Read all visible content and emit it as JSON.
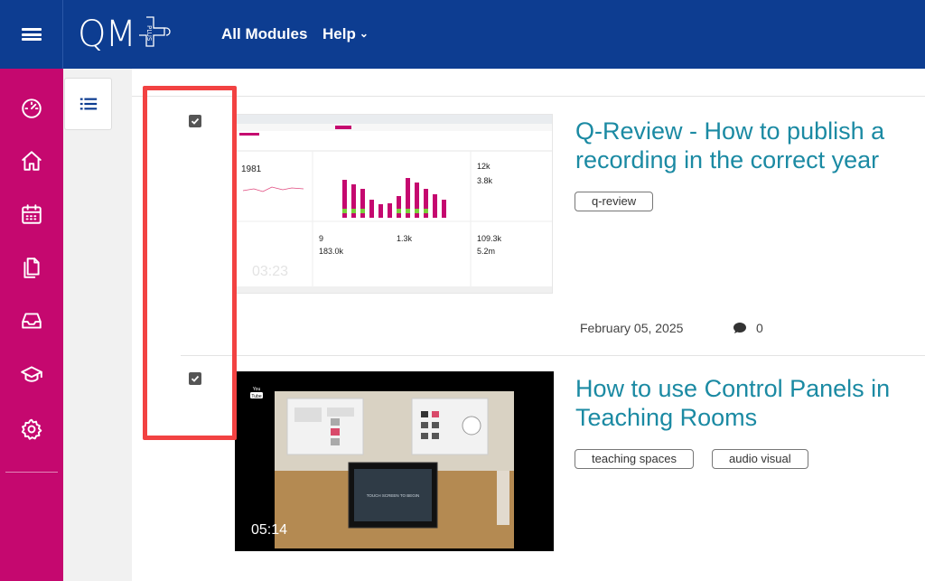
{
  "header": {
    "logo_text": "QM",
    "logo_plus_text": "PLUS",
    "nav": {
      "all_modules": "All Modules",
      "help": "Help"
    }
  },
  "sidebar": {
    "items": [
      {
        "icon": "dashboard-icon"
      },
      {
        "icon": "home-icon"
      },
      {
        "icon": "calendar-icon"
      },
      {
        "icon": "content-bank-icon"
      },
      {
        "icon": "inbox-icon"
      },
      {
        "icon": "graduation-cap-icon"
      },
      {
        "icon": "gear-icon"
      }
    ],
    "color": "#c5086f"
  },
  "videos": [
    {
      "title": "Q-Review - How to publish a recording in the correct year",
      "duration": "03:23",
      "tags": [
        "q-review"
      ],
      "date": "February 05, 2025",
      "comments": "0",
      "thumb_stats": {
        "left_big": "1981",
        "mid1": "9",
        "mid2": "183.0k",
        "mid3": "1.3k",
        "right1": "12k",
        "right2": "3.8k",
        "right3": "109.3k",
        "right4": "5.2m"
      }
    },
    {
      "title": "How to use Control Panels in Teaching Rooms",
      "duration": "05:14",
      "tags": [
        "teaching spaces",
        "audio visual"
      ],
      "screen_text": "TOUCH SCREEN TO BEGIN",
      "youtube_label": "You Tube"
    }
  ],
  "colors": {
    "brand_blue": "#0d3d91",
    "accent_magenta": "#c5086f",
    "title_teal": "#1b8aa3",
    "highlight_red": "#f24242"
  }
}
